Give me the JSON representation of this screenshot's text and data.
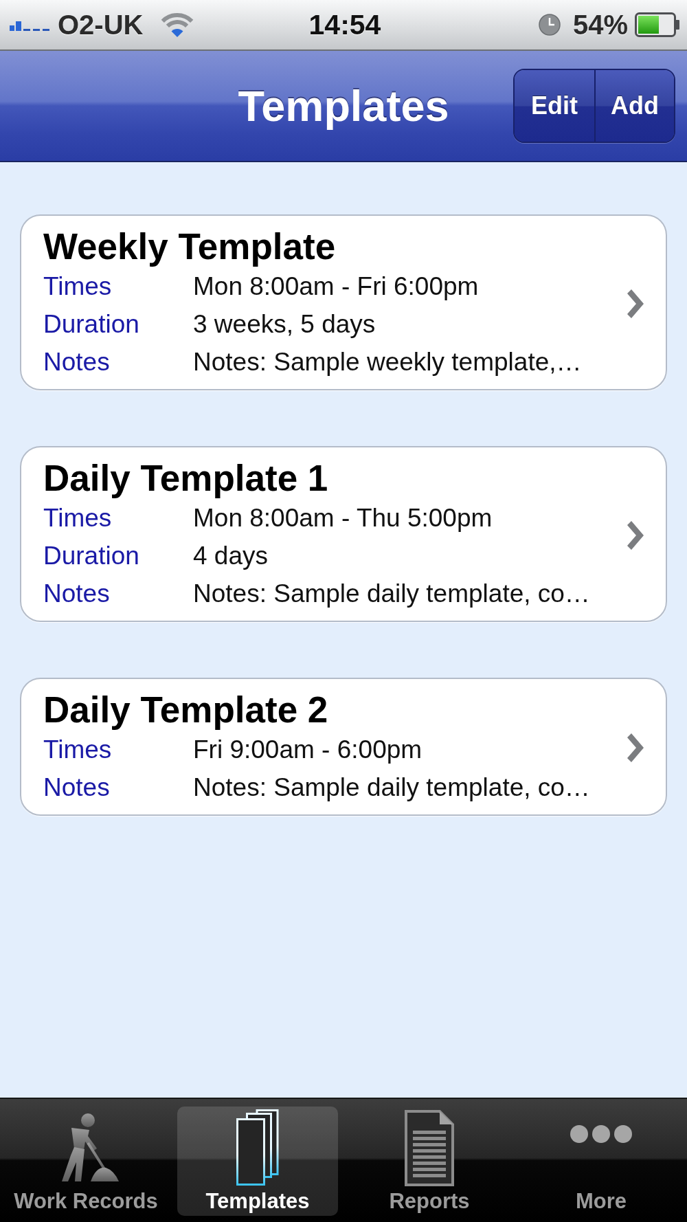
{
  "status_bar": {
    "carrier": "O2-UK",
    "time": "14:54",
    "battery": "54%"
  },
  "nav_bar": {
    "title": "Templates",
    "buttons": [
      {
        "label": "Edit"
      },
      {
        "label": "Add"
      }
    ]
  },
  "templates": [
    {
      "title": "Weekly Template",
      "fields": [
        {
          "label": "Times",
          "value": "Mon 8:00am - Fri 6:00pm"
        },
        {
          "label": "Duration",
          "value": "3 weeks, 5 days"
        },
        {
          "label": "Notes",
          "value": "Notes: Sample weekly template,…"
        }
      ]
    },
    {
      "title": "Daily Template 1",
      "fields": [
        {
          "label": "Times",
          "value": "Mon 8:00am - Thu 5:00pm"
        },
        {
          "label": "Duration",
          "value": "4 days"
        },
        {
          "label": "Notes",
          "value": "Notes: Sample daily template, co…"
        }
      ]
    },
    {
      "title": "Daily Template 2",
      "fields": [
        {
          "label": "Times",
          "value": "Fri 9:00am - 6:00pm"
        },
        {
          "label": "Notes",
          "value": "Notes: Sample daily template, co…"
        }
      ]
    }
  ],
  "tab_bar": {
    "tabs": [
      {
        "kind": "worker",
        "label": "Work Records",
        "selected": false
      },
      {
        "kind": "templates",
        "label": "Templates",
        "selected": true
      },
      {
        "kind": "document",
        "label": "Reports",
        "selected": false
      },
      {
        "kind": "more",
        "label": "More",
        "selected": false
      }
    ]
  }
}
